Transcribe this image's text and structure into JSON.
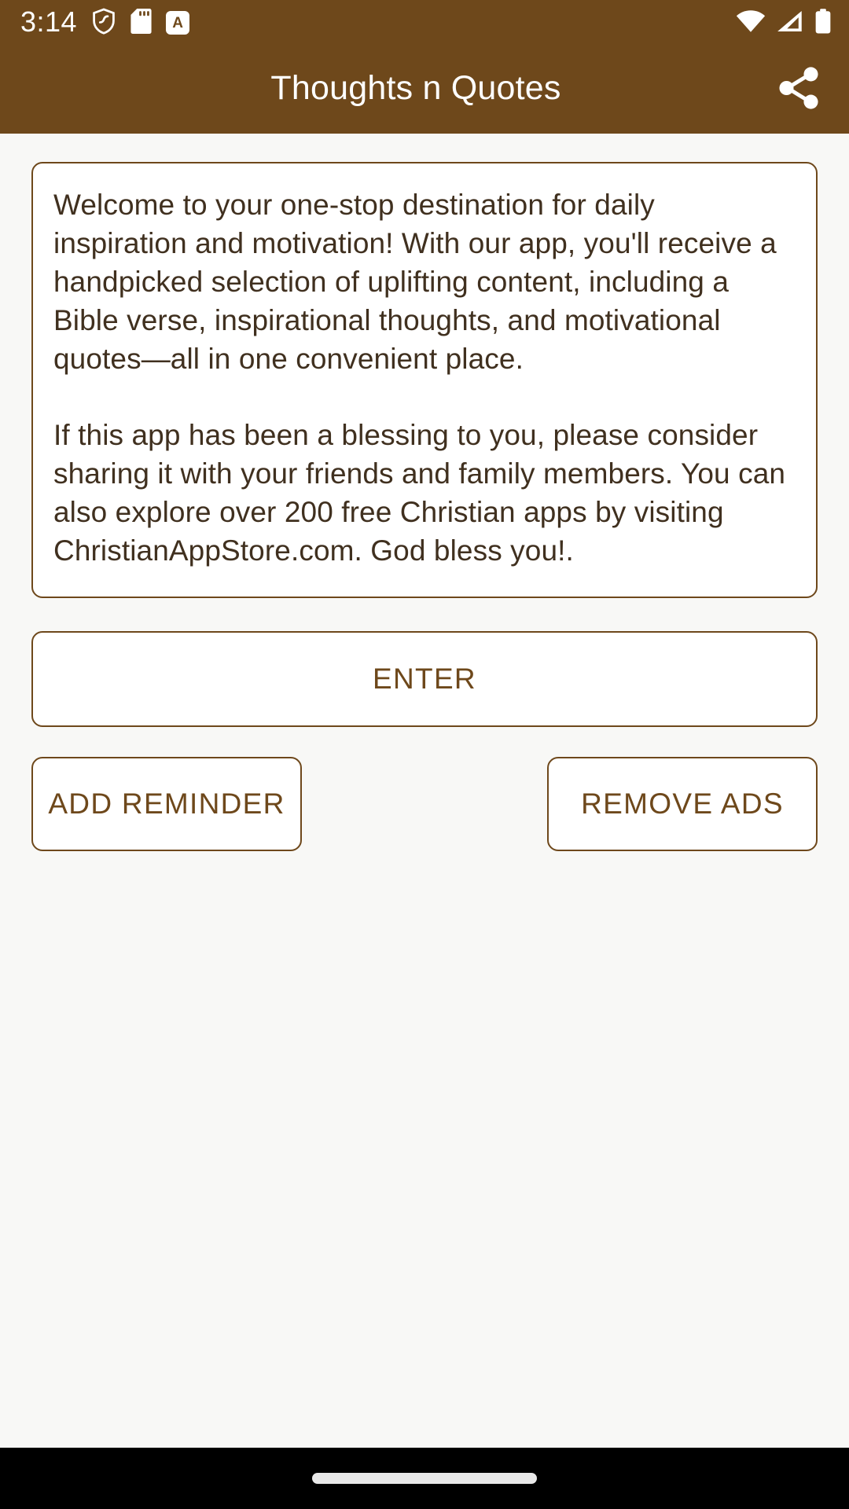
{
  "status_bar": {
    "time": "3:14",
    "icons_left": [
      "shield-icon",
      "sd-card-icon",
      "a-badge-icon"
    ],
    "a_badge_label": "A",
    "icons_right": [
      "wifi-icon",
      "cellular-signal-icon",
      "battery-icon"
    ],
    "background_color": "#6E481B",
    "foreground_color": "#FFFFFF"
  },
  "app_bar": {
    "title": "Thoughts n Quotes",
    "share_icon": "share-icon",
    "background_color": "#6E481B",
    "title_color": "#FFFFFF"
  },
  "info_card": {
    "paragraph_1": "Welcome to your one-stop destination for daily inspiration and motivation! With our app, you'll receive a handpicked selection of uplifting content, including a Bible verse, inspirational thoughts, and motivational quotes—all in one convenient place.",
    "paragraph_2": "If this app has been a blessing to you, please consider sharing it with your friends and family members. You can also explore over 200 free Christian apps by visiting ChristianAppStore.com. God bless you!.",
    "border_color": "#6E481B",
    "text_color": "#40301F",
    "background_color": "#FFFFFF"
  },
  "buttons": {
    "enter": "ENTER",
    "add_reminder": "ADD REMINDER",
    "remove_ads": "REMOVE ADS",
    "border_color": "#6E481B",
    "label_color": "#6E481B"
  },
  "nav_bar": {
    "gesture_pill": "home-gesture-pill",
    "background_color": "#000000"
  },
  "theme": {
    "brand_brown": "#6E481B",
    "page_background": "#F8F8F6"
  }
}
